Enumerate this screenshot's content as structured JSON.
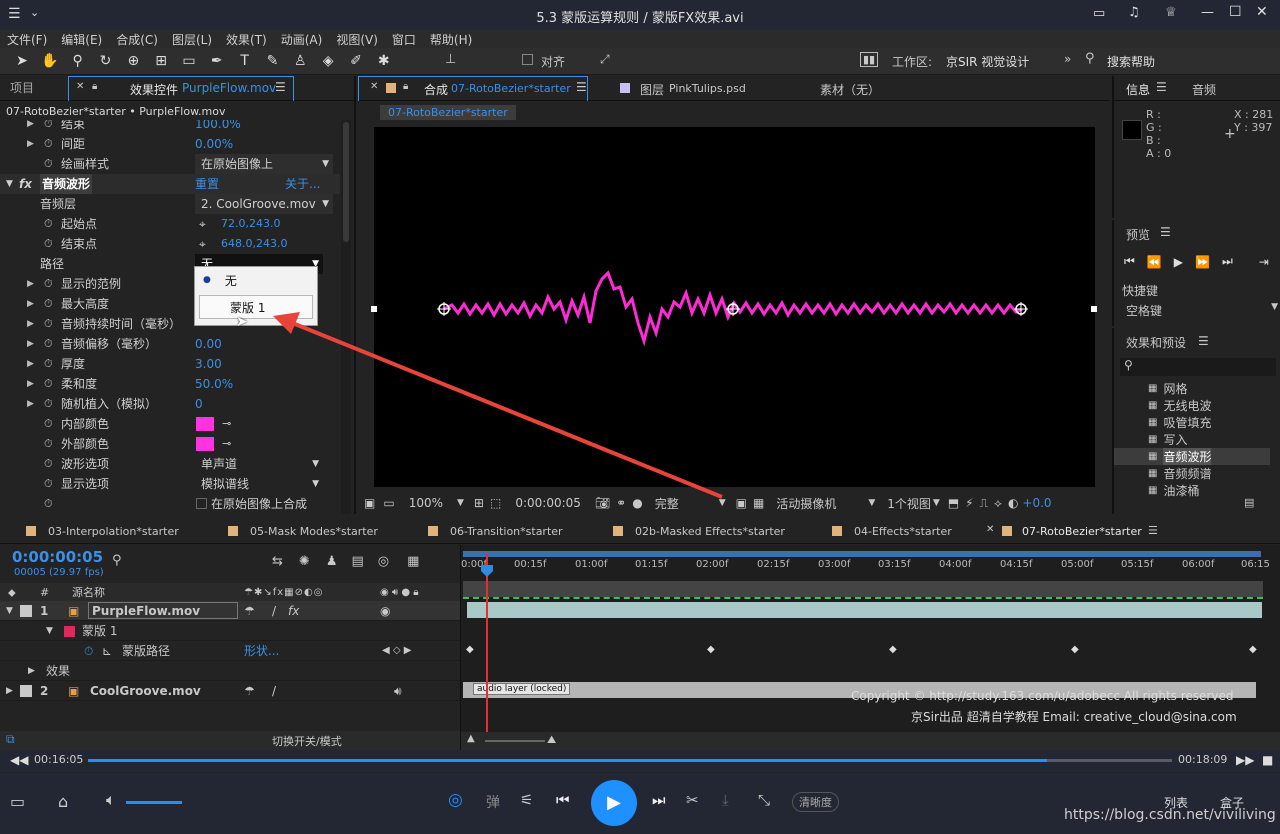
{
  "titlebar": {
    "title": "5.3 蒙版运算规则 / 蒙版FX效果.avi"
  },
  "menu": [
    "文件(F)",
    "编辑(E)",
    "合成(C)",
    "图层(L)",
    "效果(T)",
    "动画(A)",
    "视图(V)",
    "窗口",
    "帮助(H)"
  ],
  "toolbar": {
    "snap_label": "对齐",
    "workspace_label": "工作区:",
    "workspace_value": "京SIR 视觉设计",
    "search_help": "搜索帮助"
  },
  "left_panel": {
    "tab_project": "项目",
    "tab_effects": "效果控件",
    "tab_effects_file": "PurpleFlow.mov",
    "breadcrumb": "07-RotoBezier*starter • PurpleFlow.mov",
    "rows": {
      "top_partial_label": "结束",
      "top_partial_value": "100.0%",
      "spacing_label": "间距",
      "spacing_value": "0.00%",
      "paint_label": "绘画样式",
      "paint_value": "在原始图像上",
      "fx_name": "音频波形",
      "reset": "重置",
      "about": "关于...",
      "audio_layer_label": "音频层",
      "audio_layer_value": "2. CoolGroove.mov",
      "start_label": "起始点",
      "start_value": "72.0,243.0",
      "end_label": "结束点",
      "end_value": "648.0,243.0",
      "path_label": "路径",
      "path_value": "无",
      "display_range_label": "显示的范例",
      "max_height_label": "最大高度",
      "duration_label": "音频持续时间（毫秒）",
      "offset_label": "音频偏移（毫秒）",
      "offset_value": "0.00",
      "thickness_label": "厚度",
      "thickness_value": "3.00",
      "softness_label": "柔和度",
      "softness_value": "50.0%",
      "random_label": "随机植入（模拟）",
      "random_value": "0",
      "inside_color_label": "内部颜色",
      "outside_color_label": "外部颜色",
      "wave_label": "波形选项",
      "wave_value": "单声道",
      "display_label": "显示选项",
      "display_value": "模拟谱线",
      "composite_label": "在原始图像上合成"
    },
    "dropdown": {
      "option_none": "无",
      "option_mask": "蒙版 1"
    }
  },
  "comp_panel": {
    "tab_comp": "合成",
    "tab_comp_name": "07-RotoBezier*starter",
    "tab_layer": "图层",
    "tab_layer_name": "PinkTulips.psd",
    "tab_footage": "素材（无）",
    "subtab": "07-RotoBezier*starter",
    "zoom": "100%",
    "timecode": "0:00:00:05",
    "quality": "完整",
    "camera": "活动摄像机",
    "views": "1个视图",
    "exposure": "+0.0"
  },
  "info_panel": {
    "tab_info": "信息",
    "tab_audio": "音频",
    "r": "R :",
    "g": "G :",
    "b": "B :",
    "a": "A : 0",
    "x": "X : 281",
    "y": "Y : 397"
  },
  "preview_panel": {
    "title": "预览",
    "shortcut_label": "快捷键",
    "shortcut_value": "空格键"
  },
  "effects_presets": {
    "title": "效果和预设",
    "items": [
      "网格",
      "无线电波",
      "吸管填充",
      "写入",
      "音频波形",
      "音频频谱",
      "油漆桶"
    ]
  },
  "timeline_tabs": [
    "03-Interpolation*starter",
    "05-Mask Modes*starter",
    "06-Transition*starter",
    "02b-Masked Effects*starter",
    "04-Effects*starter",
    "07-RotoBezier*starter"
  ],
  "timeline": {
    "timecode": "0:00:00:05",
    "frames": "00005 (29.97 fps)",
    "col_name": "源名称",
    "layer1": {
      "num": "1",
      "name": "PurpleFlow.mov"
    },
    "mask_label": "蒙版 1",
    "mask_path_label": "蒙版路径",
    "mask_path_value": "形状...",
    "effects_label": "效果",
    "layer2": {
      "num": "2",
      "name": "CoolGroove.mov"
    },
    "ruler": [
      "0:00f",
      "00:15f",
      "01:00f",
      "01:15f",
      "02:00f",
      "02:15f",
      "03:00f",
      "03:15f",
      "04:00f",
      "04:15f",
      "05:00f",
      "05:15f",
      "06:00f",
      "06:15"
    ],
    "audio_locked": "audio layer (locked)",
    "toggle_label": "切换开关/模式",
    "copyright1": "Copyright © http://study.163.com/u/adobecc All rights reserved",
    "copyright2": "京Sir出品  超清自学教程 Email: creative_cloud@sina.com"
  },
  "player": {
    "time_current": "00:16:05",
    "time_total": "00:18:09",
    "progress": 0.885,
    "danmu": "弹",
    "clarity": "清晰度",
    "list": "列表",
    "box": "盒子",
    "watermark": "https://blog.csdn.net/viviliving"
  },
  "colors": {
    "accent": "#3b8fe6",
    "wave": "#ff2bd6",
    "swatch": "#ff33e0",
    "play": "#1e90ff",
    "arrow": "#e8443a"
  }
}
